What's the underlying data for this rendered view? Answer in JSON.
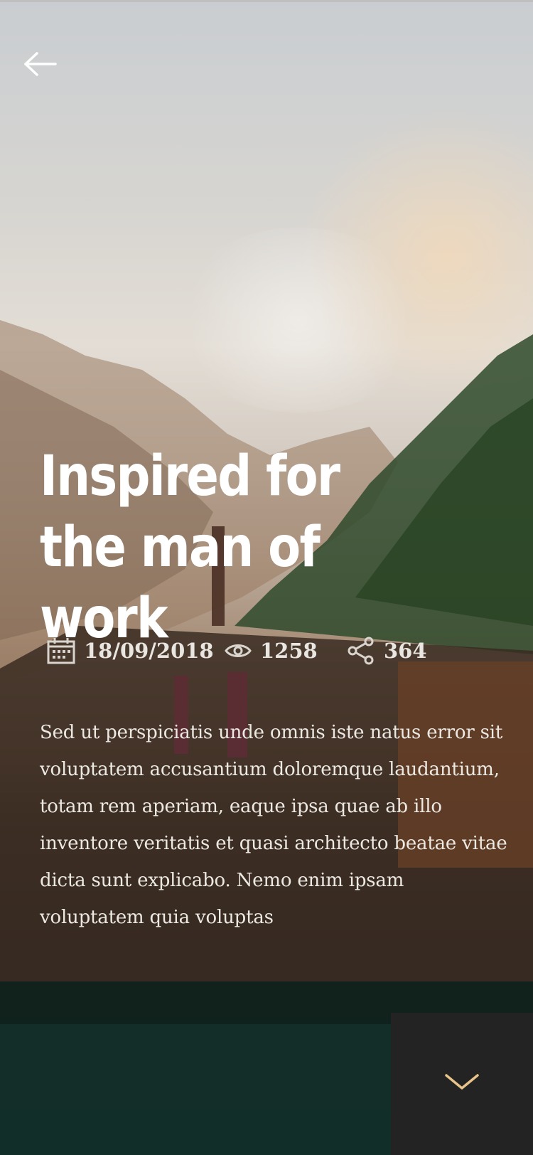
{
  "article": {
    "title_line1": "Inspired for",
    "title_line2": "the man of work",
    "date": "18/09/2018",
    "views": "1258",
    "shares": "364",
    "body": "Sed ut perspiciatis unde omnis iste natus error sit voluptatem accusantium doloremque laudantium, totam rem aperiam, eaque ipsa quae ab illo inventore veritatis et quasi architecto beatae vitae dicta sunt explicabo. Nemo enim ipsam voluptatem quia voluptas"
  },
  "icons": {
    "back": "arrow-left-icon",
    "date": "calendar-icon",
    "views": "eye-icon",
    "shares": "share-icon",
    "scroll": "chevron-down-icon"
  },
  "colors": {
    "text": "#ffffff",
    "meta": "#e9e5e0",
    "panel": "#232323",
    "accent": "#e8c48a"
  }
}
